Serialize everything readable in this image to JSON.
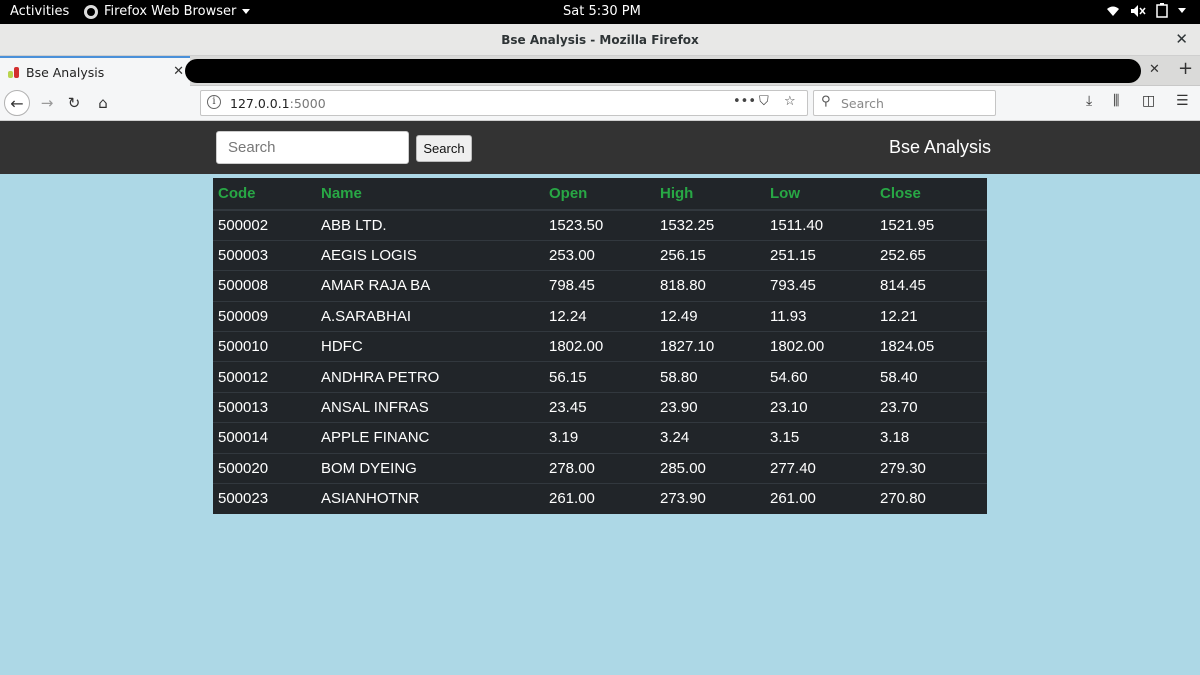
{
  "system": {
    "activities": "Activities",
    "app_name": "Firefox Web Browser",
    "clock": "Sat  5:30 PM"
  },
  "window": {
    "title": "Bse Analysis - Mozilla Firefox"
  },
  "tabs": [
    {
      "label": "Bse Analysis"
    }
  ],
  "toolbar": {
    "url_host": "127.0.0.1",
    "url_port": ":5000",
    "search_placeholder": "Search"
  },
  "page": {
    "search_placeholder": "Search",
    "search_button": "Search",
    "brand": "Bse Analysis",
    "header_color": "#28a745",
    "background_color": "#add8e6"
  },
  "table": {
    "columns": [
      "Code",
      "Name",
      "Open",
      "High",
      "Low",
      "Close"
    ],
    "rows": [
      [
        "500002",
        "ABB LTD.",
        "1523.50",
        "1532.25",
        "1511.40",
        "1521.95"
      ],
      [
        "500003",
        "AEGIS LOGIS",
        "253.00",
        "256.15",
        "251.15",
        "252.65"
      ],
      [
        "500008",
        "AMAR RAJA BA",
        "798.45",
        "818.80",
        "793.45",
        "814.45"
      ],
      [
        "500009",
        "A.SARABHAI",
        "12.24",
        "12.49",
        "11.93",
        "12.21"
      ],
      [
        "500010",
        "HDFC",
        "1802.00",
        "1827.10",
        "1802.00",
        "1824.05"
      ],
      [
        "500012",
        "ANDHRA PETRO",
        "56.15",
        "58.80",
        "54.60",
        "58.40"
      ],
      [
        "500013",
        "ANSAL INFRAS",
        "23.45",
        "23.90",
        "23.10",
        "23.70"
      ],
      [
        "500014",
        "APPLE FINANC",
        "3.19",
        "3.24",
        "3.15",
        "3.18"
      ],
      [
        "500020",
        "BOM DYEING",
        "278.00",
        "285.00",
        "277.40",
        "279.30"
      ],
      [
        "500023",
        "ASIANHOTNR",
        "261.00",
        "273.90",
        "261.00",
        "270.80"
      ]
    ]
  }
}
